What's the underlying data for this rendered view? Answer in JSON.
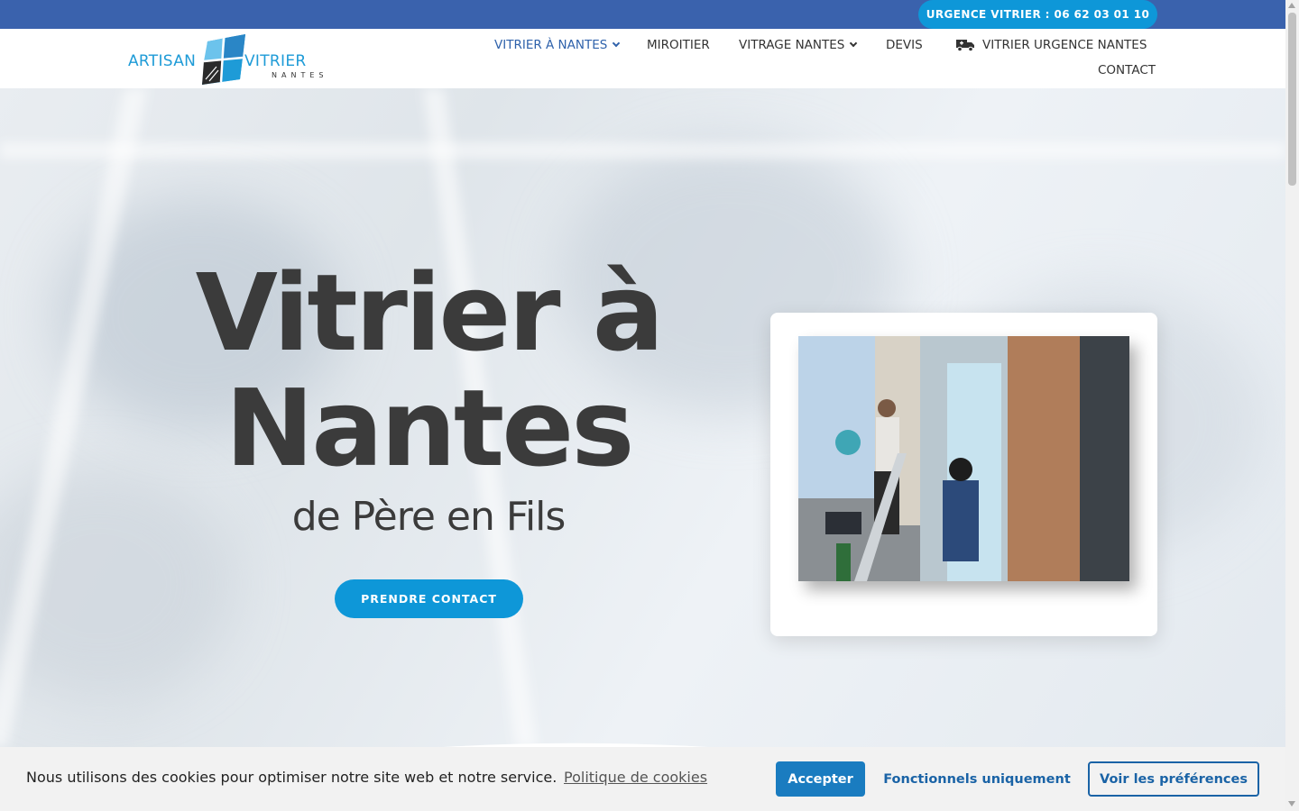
{
  "topbar": {
    "urgent_label": "URGENCE VITRIER : 06 62 03 01 10"
  },
  "logo": {
    "left_word": "ARTISAN",
    "right_word": "VITRIER",
    "sub": "NANTES"
  },
  "nav": {
    "items": [
      {
        "label": "VITRIER À NANTES",
        "dropdown": true,
        "active": true
      },
      {
        "label": "MIROITIER"
      },
      {
        "label": "VITRAGE NANTES",
        "dropdown": true
      },
      {
        "label": "DEVIS"
      },
      {
        "label": "VITRIER URGENCE NANTES",
        "icon": "truck-icon"
      },
      {
        "label": "CONTACT"
      }
    ]
  },
  "hero": {
    "title_line1": "Vitrier à",
    "title_line2": "Nantes",
    "subtitle": "de Père en Fils",
    "cta_label": "PRENDRE CONTACT"
  },
  "cookie": {
    "message": "Nous utilisons des cookies pour optimiser notre site web et notre service.",
    "policy_link": "Politique de cookies",
    "accept_label": "Accepter",
    "functional_label": "Fonctionnels uniquement",
    "prefs_label": "Voir les préférences"
  },
  "colors": {
    "topbar": "#3a62ad",
    "accent": "#0e97d8",
    "nav_active": "#2f62ab",
    "title": "#3b3b3b"
  }
}
